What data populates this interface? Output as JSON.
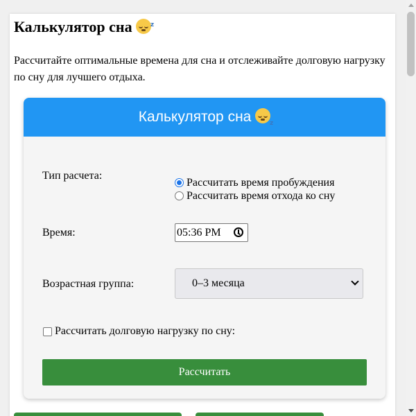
{
  "page": {
    "title": "Калькулятор сна",
    "title_emoji": "😴",
    "intro": "Рассчитайте оптимальные времена для сна и отслеживайте долговую нагрузку по сну для лучшего отдыха."
  },
  "calculator": {
    "header": "Калькулятор сна",
    "header_emoji": "😴",
    "calc_type_label": "Тип расчета:",
    "calc_type_options": [
      {
        "label": "Рассчитать время пробуждения",
        "checked": true
      },
      {
        "label": "Рассчитать время отхода ко сну",
        "checked": false
      }
    ],
    "time_label": "Время:",
    "time_value": "05:36 PM",
    "age_label": "Возрастная группа:",
    "age_value": "0–3 месяца",
    "sleep_debt_label": "Рассчитать долговую нагрузку по сну:",
    "sleep_debt_checked": false,
    "submit_label": "Рассчитать"
  },
  "colors": {
    "header_bg": "#2196f3",
    "submit_bg": "#388e3c",
    "radio_accent": "#1a73e8"
  }
}
